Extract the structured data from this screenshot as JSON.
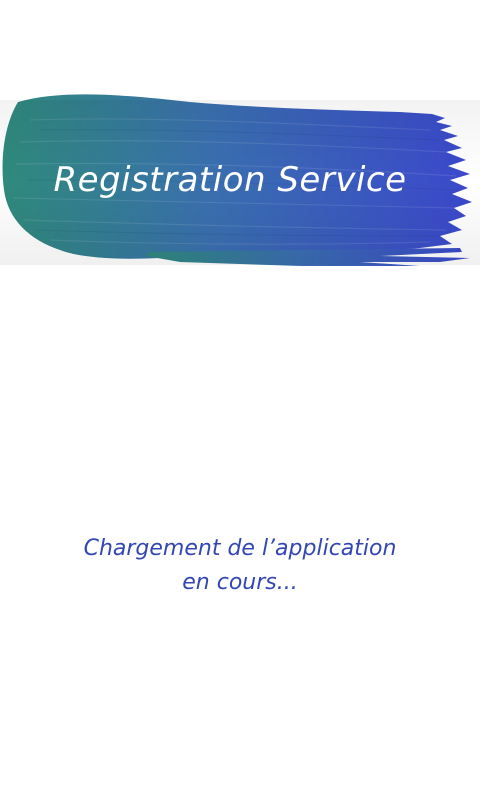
{
  "splash": {
    "title": "Registration Service",
    "loading_line1": "Chargement de l’application",
    "loading_line2": "en cours..."
  },
  "colors": {
    "background": "#ffffff",
    "brush_start": "#2f8a7c",
    "brush_mid": "#3a6fb0",
    "brush_end": "#3b48cc",
    "title_text": "#ffffff",
    "loading_text": "#3247b3"
  },
  "icons": {
    "brush_stroke": "paint-brush-stroke-banner"
  }
}
